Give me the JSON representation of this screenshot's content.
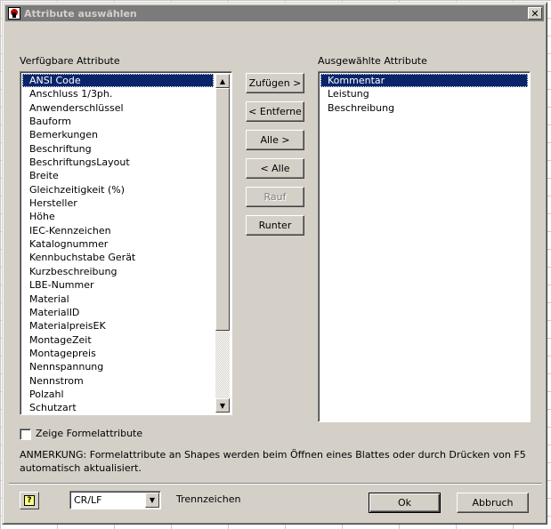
{
  "window": {
    "title": "Attribute auswählen",
    "close_glyph": "✕"
  },
  "available": {
    "label": "Verfügbare Attribute",
    "items": [
      "ANSI Code",
      "Anschluss 1/3ph.",
      "Anwenderschlüssel",
      "Bauform",
      "Bemerkungen",
      "Beschriftung",
      "BeschriftungsLayout",
      "Breite",
      "Gleichzeitigkeit (%)",
      "Hersteller",
      "Höhe",
      "IEC-Kennzeichen",
      "Katalognummer",
      "Kennbuchstabe Gerät",
      "Kurzbeschreibung",
      "LBE-Nummer",
      "Material",
      "MaterialID",
      "MaterialpreisEK",
      "MontageZeit",
      "Montagepreis",
      "Nennspannung",
      "Nennstrom",
      "Polzahl",
      "Schutzart"
    ],
    "selected": "ANSI Code"
  },
  "selected_attrs": {
    "label": "Ausgewählte Attribute",
    "items": [
      "Kommentar",
      "Leistung",
      "Beschreibung"
    ],
    "selected": "Kommentar"
  },
  "buttons": {
    "add": "Zufügen >",
    "remove": "< Entferne",
    "all_add": "Alle >",
    "all_remove": "< Alle",
    "up": "Rauf",
    "down": "Runter",
    "ok": "Ok",
    "cancel": "Abbruch"
  },
  "checkbox": {
    "label": "Zeige Formelattribute",
    "checked": false
  },
  "note": {
    "line1": "ANMERKUNG: Formelattribute an Shapes werden beim Öffnen eines Blattes oder durch Drücken von F5",
    "line2": "automatisch aktualisiert."
  },
  "separator": {
    "value": "CR/LF",
    "label": "Trennzeichen"
  },
  "help": {
    "glyph": "?"
  },
  "icons": {
    "app": "app-logo-icon",
    "scroll_up": "▲",
    "scroll_down": "▼",
    "combo_arrow": "▼"
  },
  "colors": {
    "selection": "#0a246a",
    "face": "#d4d0c8",
    "title_inactive": "#7b7b7b"
  }
}
